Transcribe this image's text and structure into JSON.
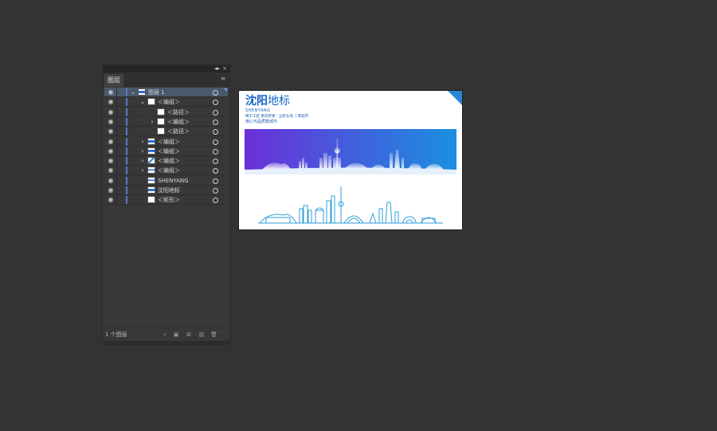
{
  "panel": {
    "tab_label": "图层",
    "collapse_glyph": "◂▸",
    "close_glyph": "×",
    "menu_glyph": "≡",
    "footer_count": "1 个图层"
  },
  "layers": [
    {
      "name": "图层 1",
      "level": 0,
      "expand": "open",
      "thumb": "banner",
      "selected": true
    },
    {
      "name": "＜编组＞",
      "level": 1,
      "expand": "open",
      "thumb": "white"
    },
    {
      "name": "＜路径＞",
      "level": 2,
      "expand": "none",
      "thumb": "white"
    },
    {
      "name": "＜编组＞",
      "level": 2,
      "expand": "closed",
      "thumb": "white"
    },
    {
      "name": "＜路径＞",
      "level": 2,
      "expand": "none",
      "thumb": "white"
    },
    {
      "name": "＜编组＞",
      "level": 1,
      "expand": "closed",
      "thumb": "banner"
    },
    {
      "name": "＜编组＞",
      "level": 1,
      "expand": "closed",
      "thumb": "banner"
    },
    {
      "name": "＜编组＞",
      "level": 1,
      "expand": "closed",
      "thumb": "diag"
    },
    {
      "name": "＜编组＞",
      "level": 1,
      "expand": "closed",
      "thumb": "text"
    },
    {
      "name": "SHENYANG",
      "level": 1,
      "expand": "none",
      "thumb": "text"
    },
    {
      "name": "沈阳地标",
      "level": 1,
      "expand": "none",
      "thumb": "banner"
    },
    {
      "name": "＜矩形＞",
      "level": 1,
      "expand": "none",
      "thumb": "white"
    }
  ],
  "footer_buttons": [
    {
      "name": "search-layer-button",
      "glyph": "⌕"
    },
    {
      "name": "make-clipping-mask-button",
      "glyph": "▣"
    },
    {
      "name": "new-sublayer-button",
      "glyph": "⊞"
    },
    {
      "name": "new-layer-button",
      "glyph": "▤"
    },
    {
      "name": "delete-layer-button",
      "glyph": "🗑"
    }
  ],
  "artboard": {
    "title_bold": "沈阳",
    "title_light": "地标",
    "subtitle": "SHENYANG",
    "slogan_line1": "精于工匠 勇筑梦想 · 立新天地 二零超市",
    "slogan_line2": "用心与品质筑城市",
    "colors": {
      "gradient_start": "#6b2fd8",
      "gradient_end": "#1a8fe0",
      "skyline": "#2e9fd8",
      "corner": "#2a86d8"
    }
  }
}
